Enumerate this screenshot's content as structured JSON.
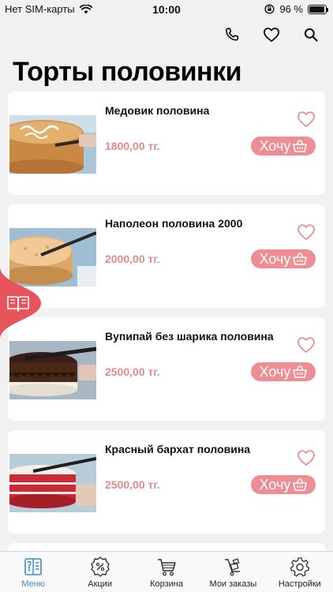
{
  "status_bar": {
    "carrier": "Нет SIM-карты",
    "time": "10:00",
    "battery_percent": "96 %",
    "battery_level": 0.96
  },
  "header": {
    "icons": [
      "phone-icon",
      "heart-icon",
      "search-icon"
    ]
  },
  "page": {
    "title": "Торты половинки"
  },
  "products": [
    {
      "name": "Медовик половина",
      "price": "1800,00 тг.",
      "button_label": "Хочу"
    },
    {
      "name": "Наполеон половина 2000",
      "price": "2000,00 тг.",
      "button_label": "Хочу"
    },
    {
      "name": "Вупипай без шарика половина",
      "price": "2500,00 тг.",
      "button_label": "Хочу"
    },
    {
      "name": "Красный бархат половина",
      "price": "2500,00 тг.",
      "button_label": "Хочу"
    }
  ],
  "tab_bar": {
    "items": [
      {
        "label": "Меню",
        "icon": "menu-book-icon",
        "active": true
      },
      {
        "label": "Акции",
        "icon": "discount-badge-icon",
        "active": false
      },
      {
        "label": "Корзина",
        "icon": "cart-icon",
        "active": false
      },
      {
        "label": "Мои заказы",
        "icon": "delivery-cart-icon",
        "active": false
      },
      {
        "label": "Настройки",
        "icon": "gear-icon",
        "active": false
      }
    ]
  },
  "colors": {
    "accent_pink": "#ee8d93",
    "price_pink": "#e28a90",
    "side_tab_red": "#e8545c",
    "active_tab_blue": "#3a8ac9"
  }
}
